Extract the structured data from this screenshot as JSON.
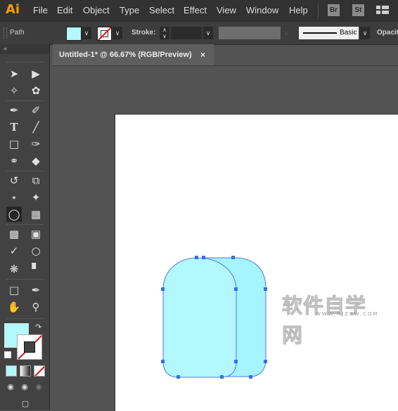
{
  "app": {
    "logo": "Ai"
  },
  "menu": {
    "items": [
      "File",
      "Edit",
      "Object",
      "Type",
      "Select",
      "Effect",
      "View",
      "Window",
      "Help"
    ]
  },
  "bridge": {
    "br": "Br",
    "st": "St"
  },
  "control_bar": {
    "selection_label": "Path",
    "fill_color": "#b3f7ff",
    "stroke_label": "Stroke:",
    "brush_label": "Basic",
    "opacity_label": "Opacity:"
  },
  "document": {
    "tab_title": "Untitled-1* @ 66.67% (RGB/Preview)",
    "close_glyph": "×"
  },
  "toolbox": {
    "tools": [
      "selection-tool",
      "direct-selection-tool",
      "magic-wand-tool",
      "lasso-tool",
      "pen-tool",
      "curvature-tool",
      "type-tool",
      "line-segment-tool",
      "rectangle-tool",
      "paintbrush-tool",
      "shaper-tool",
      "eraser-tool",
      "rotate-tool",
      "scale-tool",
      "width-tool",
      "puppet-warp-tool",
      "shape-builder-tool",
      "perspective-grid-tool",
      "mesh-tool",
      "gradient-tool",
      "eyedropper-tool",
      "blend-tool",
      "symbol-sprayer-tool",
      "column-graph-tool",
      "artboard-tool",
      "slice-tool",
      "hand-tool",
      "zoom-tool"
    ],
    "fill_color": "#b3f7ff"
  },
  "canvas": {
    "shape_fill": "#b3f7ff",
    "shape_fill_back": "#a6f4fd",
    "selection_color": "#3b6fe6"
  },
  "watermark": {
    "cn": "软件自学网",
    "en": "WWW.RJZXW.COM"
  }
}
